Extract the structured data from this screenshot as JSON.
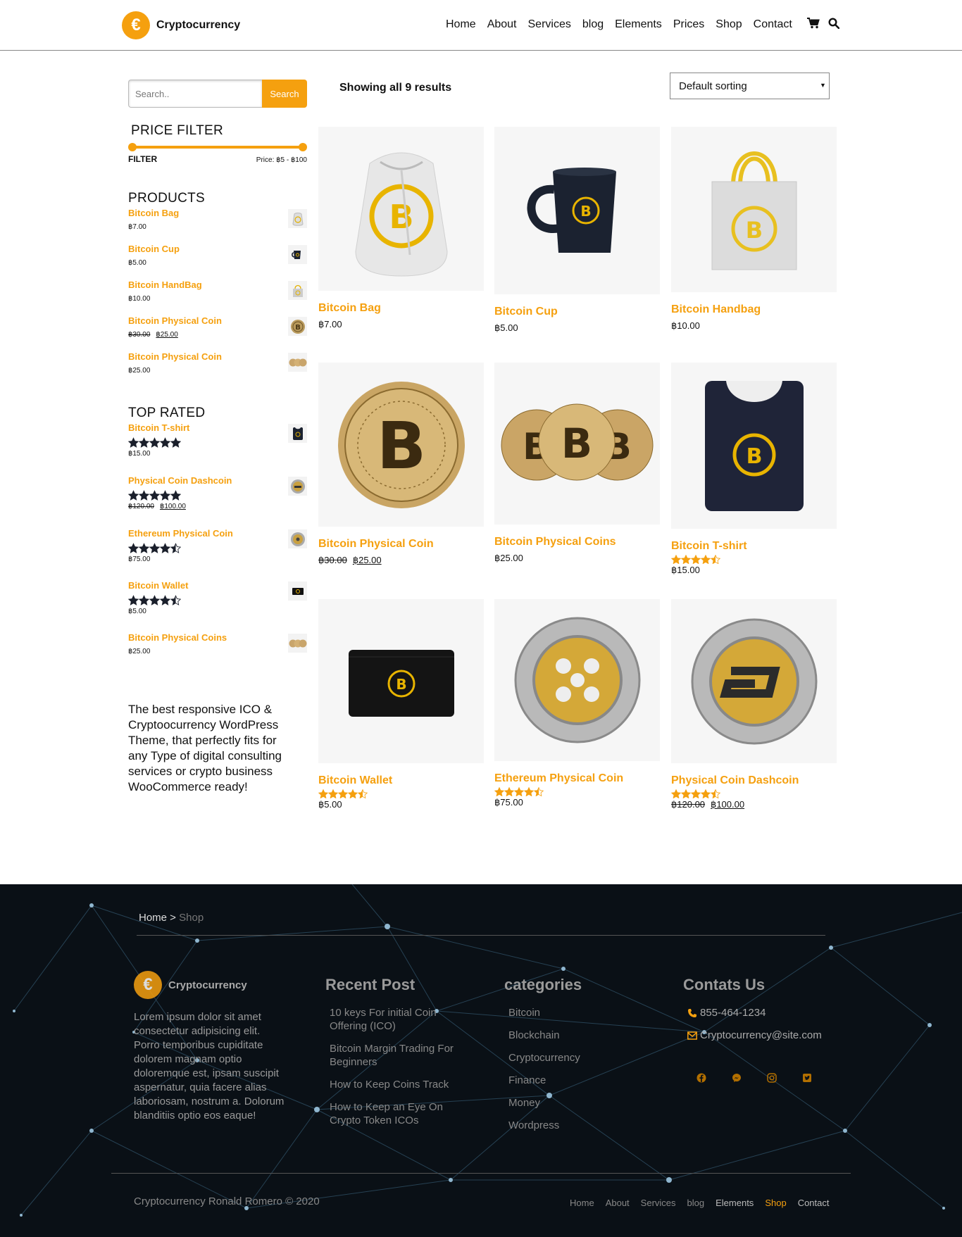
{
  "brand": {
    "name": "Cryptocurrency",
    "logo_symbol": "€",
    "accent": "#f5a00f"
  },
  "nav": {
    "items": [
      {
        "label": "Home"
      },
      {
        "label": "About"
      },
      {
        "label": "Services"
      },
      {
        "label": "blog"
      },
      {
        "label": "Elements"
      },
      {
        "label": "Prices"
      },
      {
        "label": "Shop"
      },
      {
        "label": "Contact"
      }
    ],
    "icons": [
      "cart-icon",
      "search-icon"
    ]
  },
  "sidebar": {
    "search": {
      "placeholder": "Search..",
      "button": "Search"
    },
    "price_filter": {
      "title": "PRICE FILTER",
      "filter_label": "FILTER",
      "price_text": "Price: ฿5 - ฿100",
      "range_min": 5,
      "range_max": 100
    },
    "products": {
      "title": "PRODUCTS",
      "items": [
        {
          "name": "Bitcoin Bag",
          "price": "฿7.00",
          "thumb": "bag-thumb"
        },
        {
          "name": "Bitcoin Cup",
          "price": "฿5.00",
          "thumb": "cup-thumb"
        },
        {
          "name": "Bitcoin HandBag",
          "price": "฿10.00",
          "thumb": "handbag-thumb"
        },
        {
          "name": "Bitcoin Physical Coin",
          "old_price": "฿30.00",
          "price": "฿25.00",
          "thumb": "coin-thumb"
        },
        {
          "name": "Bitcoin Physical Coin",
          "price": "฿25.00",
          "thumb": "coins-thumb"
        }
      ]
    },
    "top_rated": {
      "title": "TOP RATED",
      "items": [
        {
          "name": "Bitcoin T-shirt",
          "rating": 5,
          "price": "฿15.00",
          "thumb": "tshirt-thumb"
        },
        {
          "name": "Physical Coin Dashcoin",
          "rating": 5,
          "old_price": "฿120.00",
          "price": "฿100.00",
          "thumb": "dash-thumb"
        },
        {
          "name": "Ethereum Physical Coin",
          "rating": 4.5,
          "price": "฿75.00",
          "thumb": "eth-thumb"
        },
        {
          "name": "Bitcoin Wallet",
          "rating": 4.5,
          "price": "฿5.00",
          "thumb": "wallet-thumb"
        },
        {
          "name": "Bitcoin Physical Coins",
          "price": "฿25.00",
          "thumb": "coins-thumb"
        }
      ]
    },
    "description": "The best responsive ICO & Cryptoocurrency WordPress Theme, that perfectly fits for any Type of digital consulting services or crypto business WooCommerce ready!"
  },
  "shop": {
    "results": "Showing all 9 results",
    "sorting": "Default sorting",
    "products": [
      {
        "name": "Bitcoin Bag",
        "price": "฿7.00",
        "image": "bag-image"
      },
      {
        "name": "Bitcoin Cup",
        "price": "฿5.00",
        "image": "cup-image"
      },
      {
        "name": "Bitcoin Handbag",
        "price": "฿10.00",
        "image": "handbag-image"
      },
      {
        "name": "Bitcoin Physical Coin",
        "old_price": "฿30.00",
        "price": "฿25.00",
        "image": "coin-image"
      },
      {
        "name": "Bitcoin Physical Coins",
        "price": "฿25.00",
        "image": "coins-image"
      },
      {
        "name": "Bitcoin T-shirt",
        "rating": 4.5,
        "price": "฿15.00",
        "image": "tshirt-image"
      },
      {
        "name": "Bitcoin Wallet",
        "rating": 4.5,
        "price": "฿5.00",
        "image": "wallet-image"
      },
      {
        "name": "Ethereum Physical Coin",
        "rating": 4.5,
        "price": "฿75.00",
        "image": "ripple-coin-image"
      },
      {
        "name": "Physical Coin Dashcoin",
        "rating": 4.5,
        "old_price": "฿120.00",
        "price": "฿100.00",
        "image": "dash-coin-image"
      }
    ]
  },
  "footer": {
    "breadcrumb": {
      "home": "Home",
      "separator": " > ",
      "current": "Shop"
    },
    "about": "Lorem ipsum dolor sit amet consectetur adipisicing elit. Porro temporibus cupiditate dolorem magnam optio doloremque est, ipsam suscipit aspernatur, quia facere alias laboriosam, nostrum a. Dolorum blanditiis optio eos eaque!",
    "recent_post": {
      "title": "Recent Post",
      "items": [
        "10 keys For initial Coin Offering (ICO)",
        "Bitcoin Margin Trading For Beginners",
        "How to Keep Coins Track",
        "How to Keep an Eye On Crypto Token ICOs"
      ]
    },
    "categories": {
      "title": "categories",
      "items": [
        "Bitcoin",
        "Blockchain",
        "Cryptocurrency",
        "Finance",
        "Money",
        "Wordpress"
      ]
    },
    "contact": {
      "title": "Contats Us",
      "phone": "855-464-1234",
      "email": "Cryptocurrency@site.com",
      "social": [
        "facebook-icon",
        "messenger-icon",
        "instagram-icon",
        "twitter-icon"
      ]
    },
    "copyright": "Cryptocurrency Ronald Romero © 2020",
    "nav": [
      "Home",
      "About",
      "Services",
      "blog",
      "Elements",
      "Shop",
      "Contact"
    ],
    "active": "Shop"
  }
}
